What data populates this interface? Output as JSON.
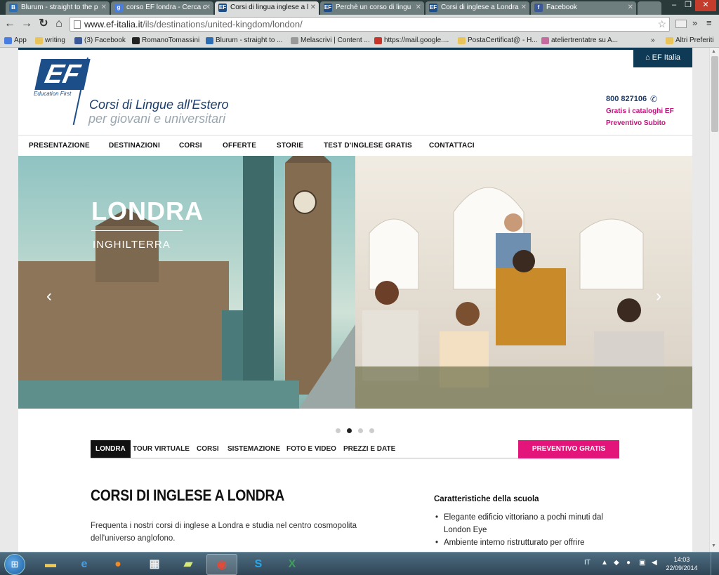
{
  "browser": {
    "tabs": [
      {
        "title": "Blurum - straight to the p",
        "icon": "blurum-icon",
        "active": false
      },
      {
        "title": "corso EF londra - Cerca c",
        "icon": "google-icon",
        "active": false
      },
      {
        "title": "Corsi di lingua inglese a l",
        "icon": "ef-icon",
        "active": true
      },
      {
        "title": "Perchè un corso di lingu",
        "icon": "ef-icon",
        "active": false
      },
      {
        "title": "Corsi di inglese a Londra",
        "icon": "ef-icon",
        "active": false
      },
      {
        "title": "Facebook",
        "icon": "facebook-icon",
        "active": false
      }
    ],
    "url_host": "www.ef-italia.it",
    "url_path": "/ils/destinations/united-kingdom/london/",
    "bookmarks": [
      "App",
      "writing",
      "(3) Facebook",
      "RomanoTomassini",
      "Blurum - straight to ...",
      "Melascrivi | Content ...",
      "https://mail.google....",
      "PostaCertificat@ - H...",
      "ateliertrentatre su A...",
      "»",
      "Altri Preferiti"
    ]
  },
  "site": {
    "ef_italia": "EF Italia",
    "logo_sub": "Education First",
    "tagline1": "Corsi di Lingue all'Estero",
    "tagline2": "per giovani e universitari",
    "phone": "800 827106",
    "link_catalog": "Gratis i cataloghi EF",
    "link_quote": "Preventivo Subito",
    "nav": [
      "PRESENTAZIONE",
      "DESTINAZIONI",
      "CORSI",
      "OFFERTE",
      "STORIE",
      "TEST D'INGLESE GRATIS",
      "CONTATTACI"
    ],
    "hero_title": "LONDRA",
    "hero_subtitle": "INGHILTERRA",
    "subnav": [
      "LONDRA",
      "TOUR VIRTUALE",
      "CORSI",
      "SISTEMAZIONE",
      "FOTO E VIDEO",
      "PREZZI E DATE"
    ],
    "cta": "PREVENTIVO GRATIS",
    "page_title": "CORSI DI INGLESE A LONDRA",
    "intro": "Frequenta i nostri corsi di inglese a Londra e studia nel centro cosmopolita dell'universo anglofono.",
    "features_title": "Caratteristiche della scuola",
    "features": [
      "Elegante edificio vittoriano a pochi minuti dal London Eye",
      "Ambiente interno ristrutturato per offrire"
    ]
  },
  "taskbar": {
    "language": "IT",
    "time": "14:03",
    "date": "22/09/2014"
  },
  "colors": {
    "brand_blue": "#1c4e8a",
    "nav_dark": "#0e3a55",
    "cta_pink": "#e3147a",
    "link_magenta": "#c0137c"
  }
}
